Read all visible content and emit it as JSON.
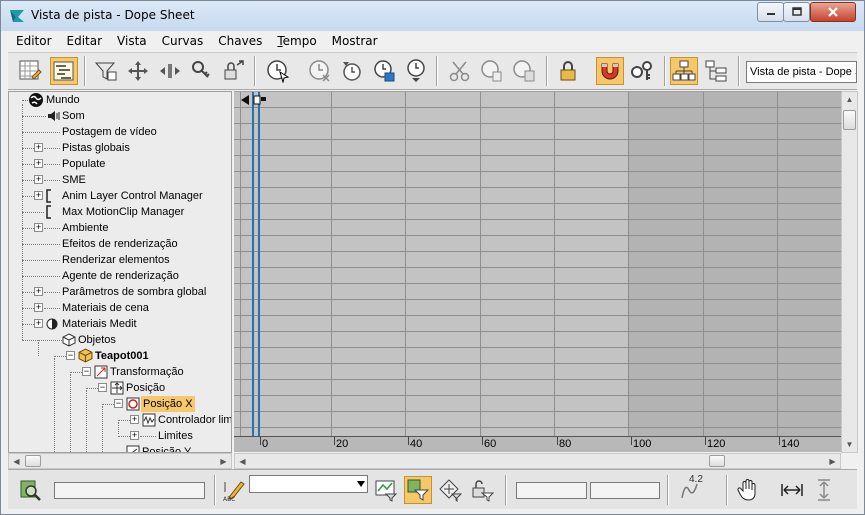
{
  "window": {
    "title": "Vista de pista - Dope Sheet"
  },
  "menu": [
    "Editor",
    "Editar",
    "Vista",
    "Curvas",
    "Chaves",
    "Tempo",
    "Mostrar"
  ],
  "toolbar": {
    "view_name": "Vista de pista - Dope S"
  },
  "tree": {
    "items": [
      {
        "label": "Mundo"
      },
      {
        "label": "Som"
      },
      {
        "label": "Postagem de vídeo"
      },
      {
        "label": "Pistas globais"
      },
      {
        "label": "Populate"
      },
      {
        "label": "SME"
      },
      {
        "label": "Anim Layer Control Manager"
      },
      {
        "label": "Max MotionClip Manager"
      },
      {
        "label": "Ambiente"
      },
      {
        "label": "Efeitos de renderização"
      },
      {
        "label": "Renderizar elementos"
      },
      {
        "label": "Agente de renderização"
      },
      {
        "label": "Parâmetros de sombra global"
      },
      {
        "label": "Materiais de cena"
      },
      {
        "label": "Materiais Medit"
      },
      {
        "label": "Objetos"
      },
      {
        "label": "Teapot001"
      },
      {
        "label": "Transformação"
      },
      {
        "label": "Posição"
      },
      {
        "label": "Posição X"
      },
      {
        "label": "Controlador limite"
      },
      {
        "label": "Limites"
      },
      {
        "label": "Posição Y"
      }
    ]
  },
  "ruler": {
    "labels": [
      "0",
      "20",
      "40",
      "60",
      "80",
      "100",
      "120",
      "140"
    ]
  },
  "bottom": {
    "value_readout": "4.2"
  },
  "colors": {
    "accent": "#f6c86a",
    "time_slider": "#2a6fb0",
    "sheet_active": "#c3c3c3",
    "sheet_inactive": "#b3b3b3"
  }
}
